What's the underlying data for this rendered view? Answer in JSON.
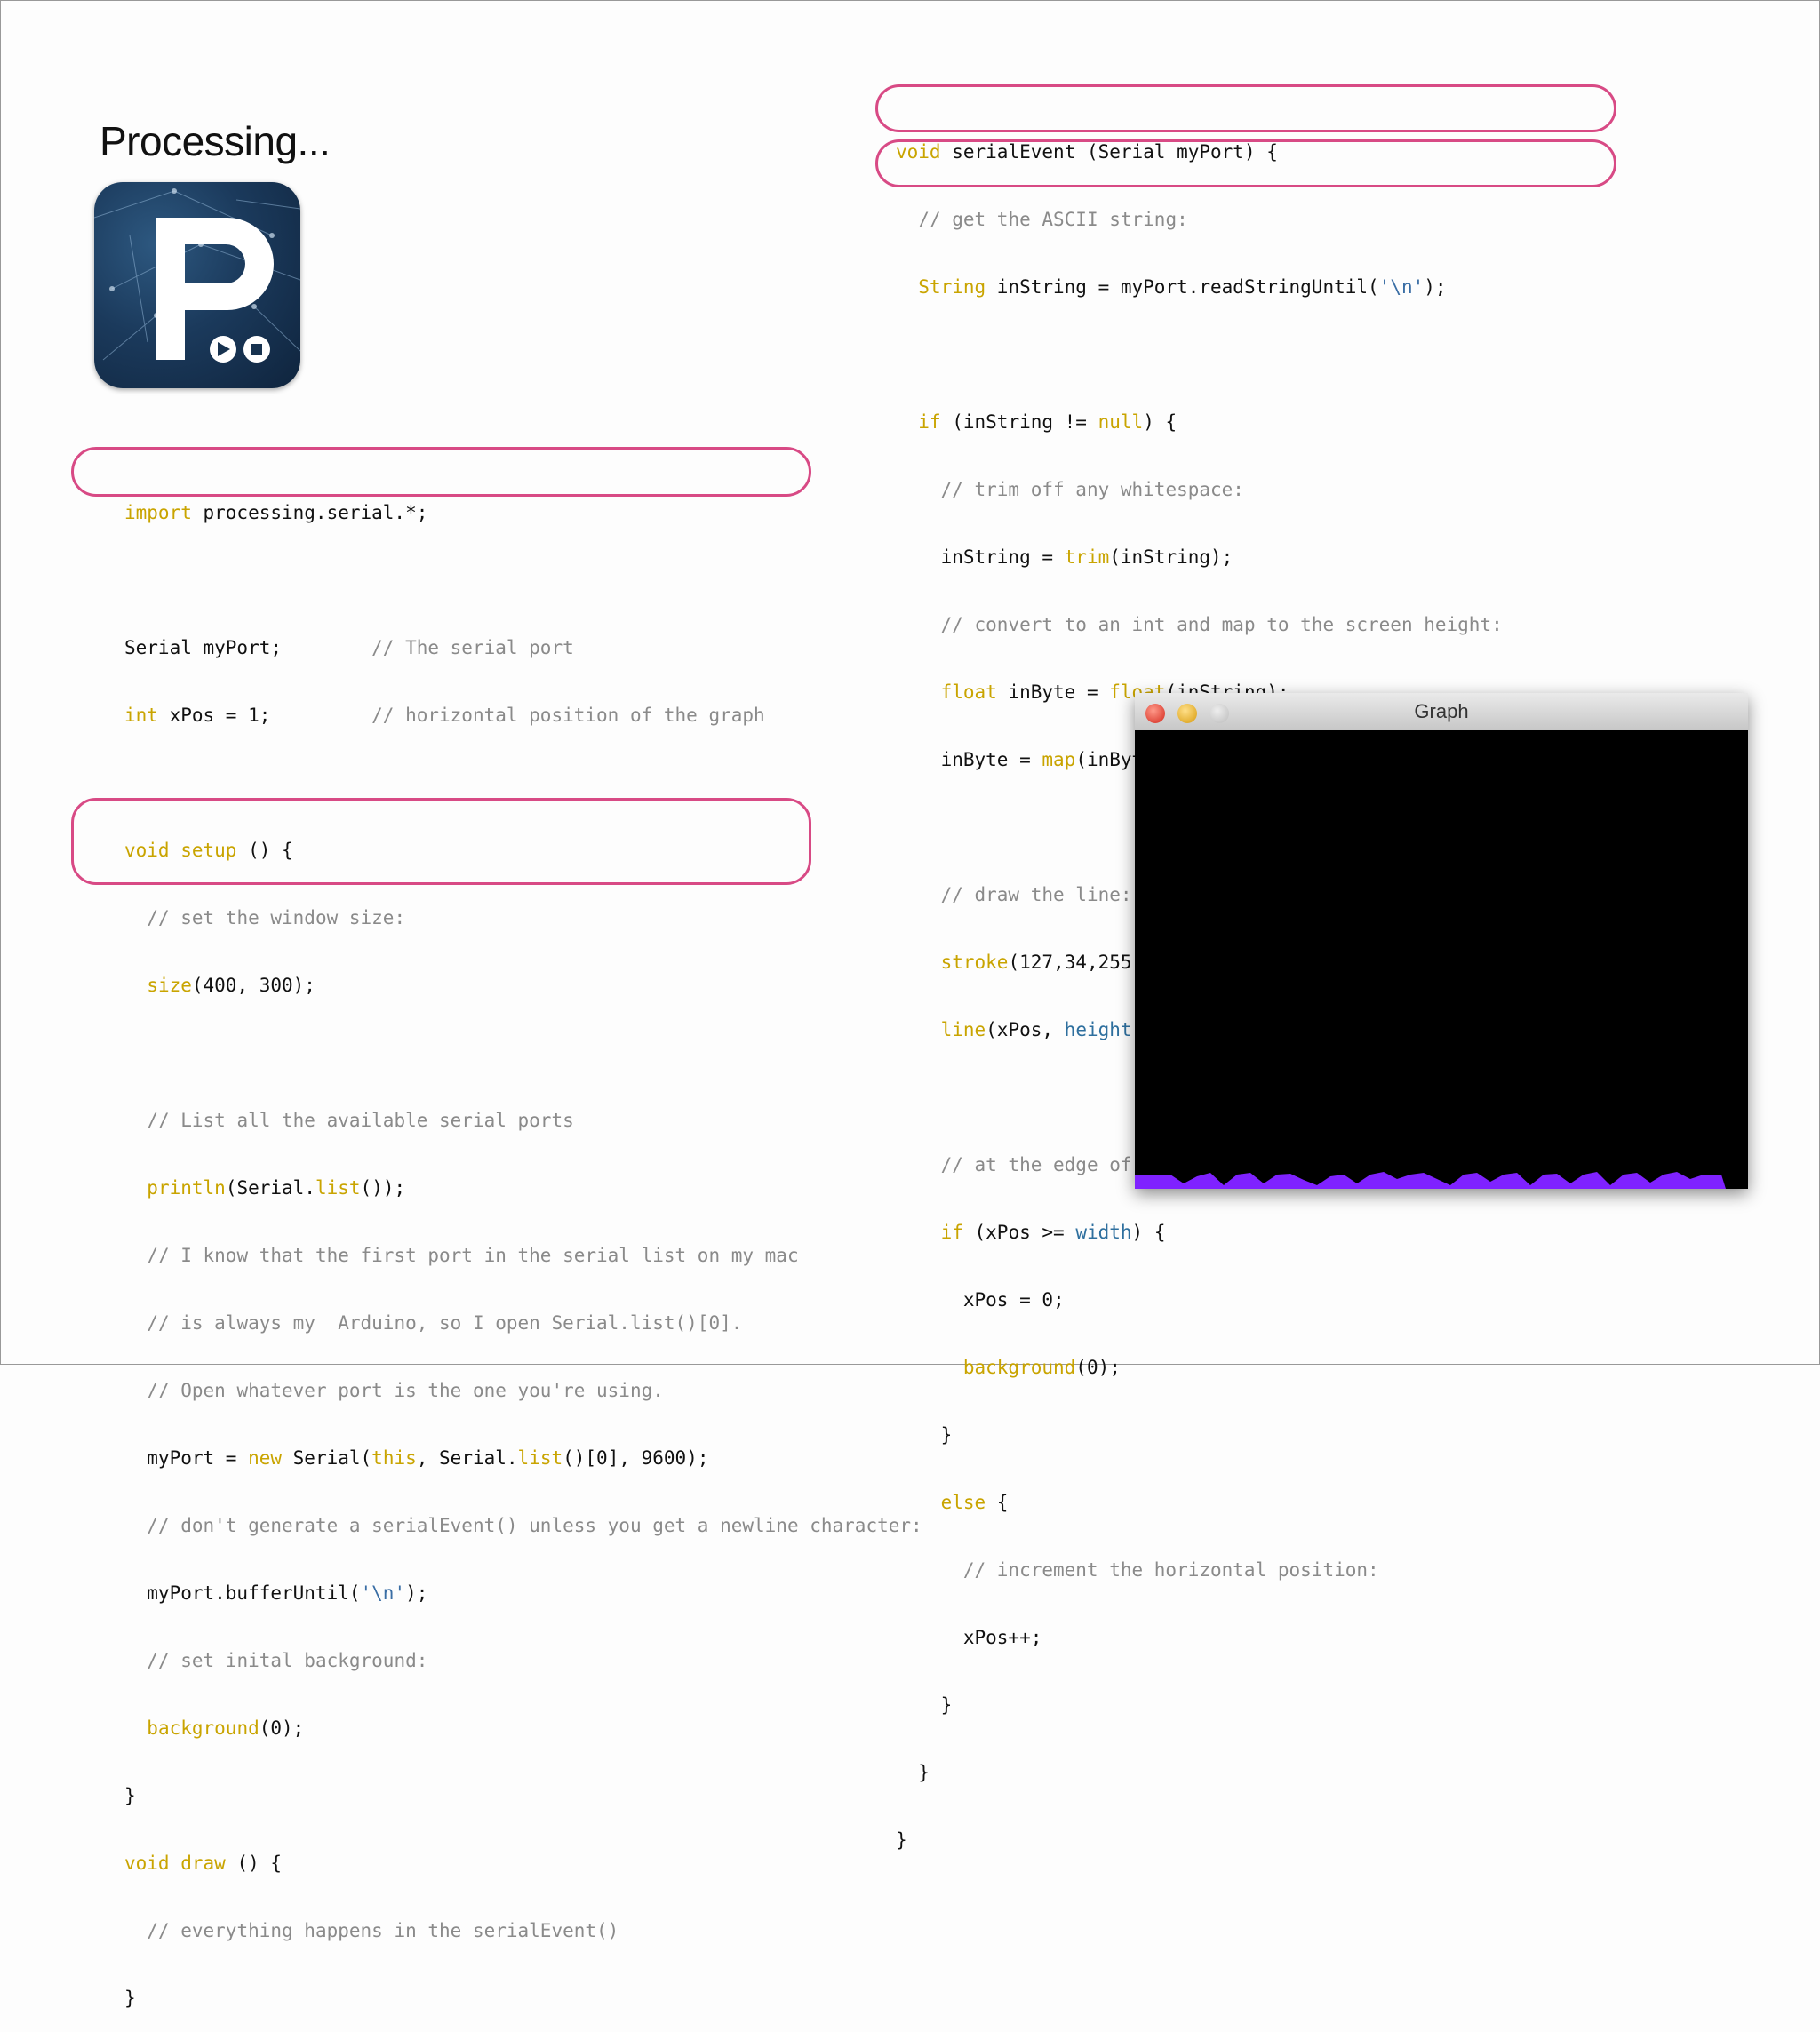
{
  "slide": {
    "title": "Processing..."
  },
  "graph_window": {
    "title": "Graph",
    "stroke_color": "#7f22ff"
  },
  "code_left": [
    "import processing.serial.*;",
    "",
    "Serial myPort;        // The serial port",
    "int xPos = 1;         // horizontal position of the graph",
    "",
    "void setup () {",
    "  // set the window size:",
    "  size(400, 300);",
    "",
    "  // List all the available serial ports",
    "  println(Serial.list());",
    "  // I know that the first port in the serial list on my mac",
    "  // is always my  Arduino, so I open Serial.list()[0].",
    "  // Open whatever port is the one you're using.",
    "  myPort = new Serial(this, Serial.list()[0], 9600);",
    "  // don't generate a serialEvent() unless you get a newline character:",
    "  myPort.bufferUntil('\\n');",
    "  // set inital background:",
    "  background(0);",
    "}",
    "void draw () {",
    "  // everything happens in the serialEvent()",
    "}"
  ],
  "code_right": [
    "void serialEvent (Serial myPort) {",
    "  // get the ASCII string:",
    "  String inString = myPort.readStringUntil('\\n');",
    "",
    "  if (inString != null) {",
    "    // trim off any whitespace:",
    "    inString = trim(inString);",
    "    // convert to an int and map to the screen height:",
    "    float inByte = float(inString);",
    "    inByte = map(inByte, 0, 1023, 0, height);",
    "",
    "    // draw the line:",
    "    stroke(127,34,255);",
    "    line(xPos, height, xPos, height - inByte);",
    "",
    "    // at the edge of the screen, go back to the beginning:",
    "    if (xPos >= width) {",
    "      xPos = 0;",
    "      background(0);",
    "    }",
    "    else {",
    "      // increment the horizontal position:",
    "      xPos++;",
    "    }",
    "  }",
    "}"
  ]
}
